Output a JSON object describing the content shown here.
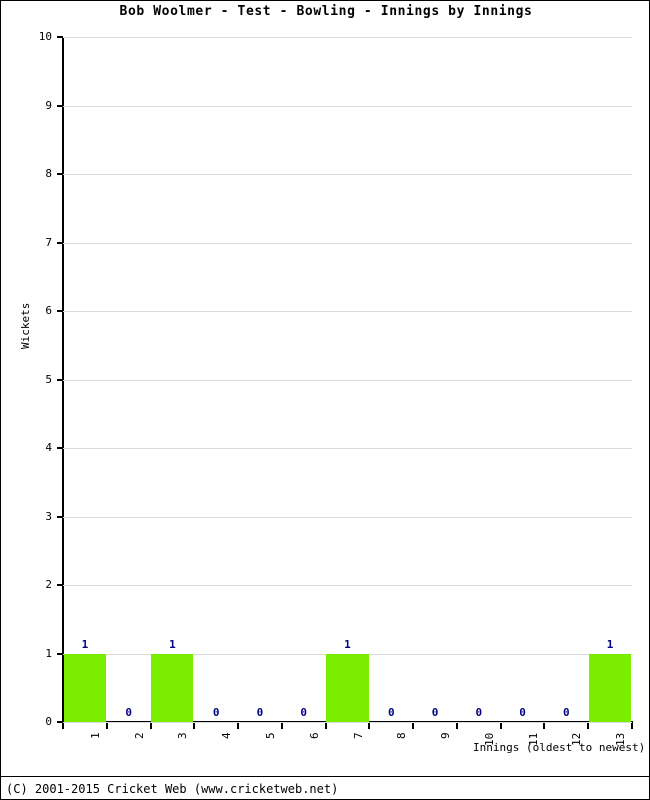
{
  "chart_data": {
    "type": "bar",
    "title": "Bob Woolmer - Test - Bowling - Innings by Innings",
    "xlabel": "Innings (oldest to newest)",
    "ylabel": "Wickets",
    "categories": [
      "1",
      "2",
      "3",
      "4",
      "5",
      "6",
      "7",
      "8",
      "9",
      "10",
      "11",
      "12",
      "13"
    ],
    "values": [
      1,
      0,
      1,
      0,
      0,
      0,
      1,
      0,
      0,
      0,
      0,
      0,
      1
    ],
    "data_labels": [
      "1",
      "0",
      "1",
      "0",
      "0",
      "0",
      "1",
      "0",
      "0",
      "0",
      "0",
      "0",
      "1"
    ],
    "ylim": [
      0,
      10
    ],
    "ytick_labels": [
      "0",
      "1",
      "2",
      "3",
      "4",
      "5",
      "6",
      "7",
      "8",
      "9",
      "10"
    ],
    "ytick_values": [
      0,
      1,
      2,
      3,
      4,
      5,
      6,
      7,
      8,
      9,
      10
    ],
    "grid": true,
    "legend": false,
    "bar_color": "#7bee00",
    "label_color": "#000080",
    "grid_color": "#dcdcdc",
    "axis_color": "#000000"
  },
  "footer": {
    "copyright": "(C) 2001-2015 Cricket Web (www.cricketweb.net)"
  }
}
